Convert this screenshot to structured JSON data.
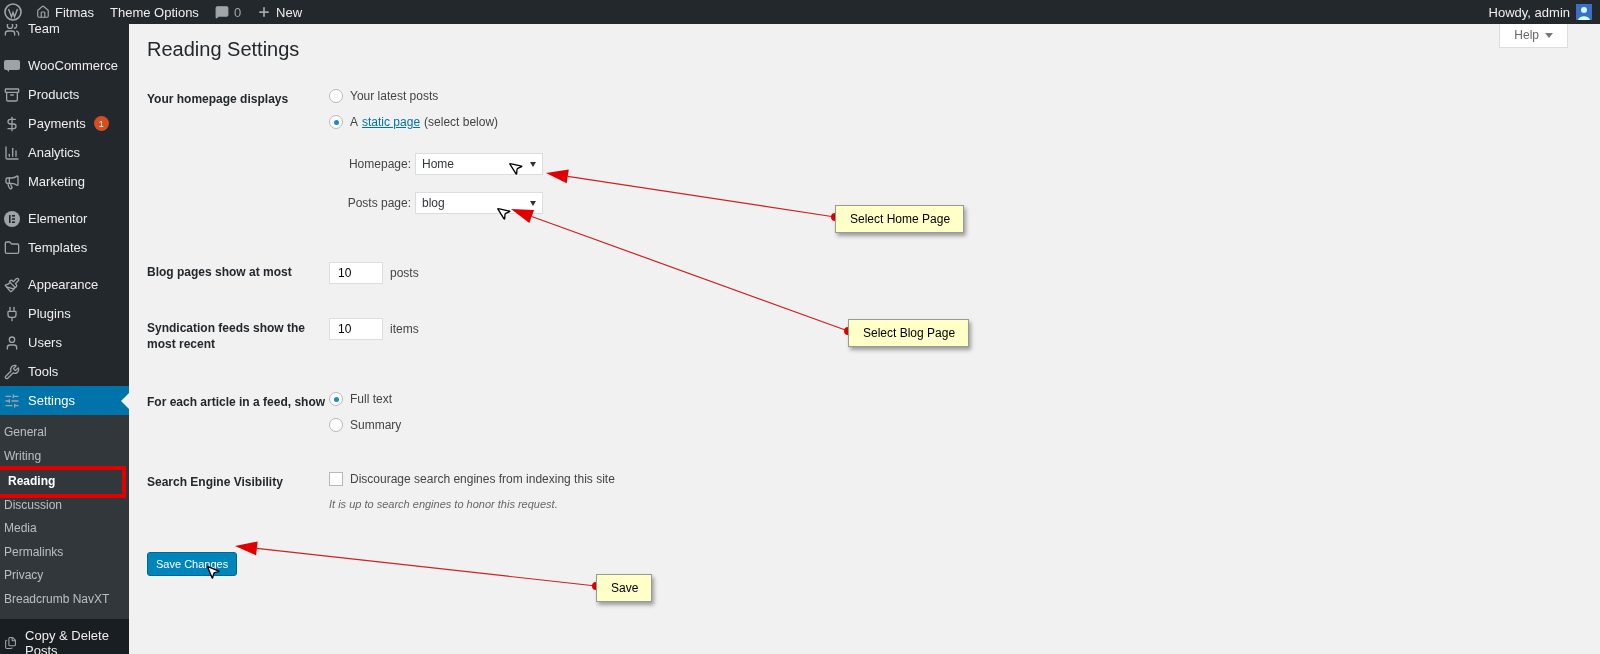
{
  "admin_bar": {
    "items": [
      {
        "kind": "logo"
      },
      {
        "kind": "home",
        "label": "Fitmas"
      },
      {
        "kind": "text",
        "label": "Theme Options"
      },
      {
        "kind": "comments",
        "label": "0"
      },
      {
        "kind": "new",
        "label": "New"
      }
    ],
    "account": "Howdy, admin"
  },
  "sidebar": {
    "groups": [
      [
        {
          "kind": "team",
          "label": "Team",
          "selected": false
        }
      ],
      [
        {
          "kind": "woo",
          "label": "WooCommerce",
          "selected": false
        },
        {
          "kind": "products",
          "label": "Products",
          "selected": false
        },
        {
          "kind": "payments",
          "label": "Payments",
          "badge": "1",
          "selected": false
        },
        {
          "kind": "analytics",
          "label": "Analytics",
          "selected": false
        },
        {
          "kind": "marketing",
          "label": "Marketing",
          "selected": false
        }
      ],
      [
        {
          "kind": "elementor",
          "label": "Elementor",
          "selected": false
        },
        {
          "kind": "templates",
          "label": "Templates",
          "selected": false
        }
      ],
      [
        {
          "kind": "appearance",
          "label": "Appearance",
          "selected": false
        },
        {
          "kind": "plugins",
          "label": "Plugins",
          "selected": false
        },
        {
          "kind": "users",
          "label": "Users",
          "selected": false
        },
        {
          "kind": "tools",
          "label": "Tools",
          "selected": false
        },
        {
          "kind": "settings",
          "label": "Settings",
          "selected": true
        }
      ]
    ],
    "submenu": [
      {
        "label": "General",
        "selected": false,
        "highlighted": false
      },
      {
        "label": "Writing",
        "selected": false,
        "highlighted": false
      },
      {
        "label": "Reading",
        "selected": true,
        "highlighted": true
      },
      {
        "label": "Discussion",
        "selected": false,
        "highlighted": false
      },
      {
        "label": "Media",
        "selected": false,
        "highlighted": false
      },
      {
        "label": "Permalinks",
        "selected": false,
        "highlighted": false
      },
      {
        "label": "Privacy",
        "selected": false,
        "highlighted": false
      },
      {
        "label": "Breadcrumb NavXT",
        "selected": false,
        "highlighted": false
      }
    ],
    "after": [
      {
        "kind": "copy",
        "label": "Copy & Delete Posts",
        "selected": false
      }
    ]
  },
  "help": "Help",
  "title": "Reading Settings",
  "rows": [
    {
      "kind": "radio_group",
      "label": "Your homepage displays",
      "options": [
        {
          "label": "Your latest posts",
          "selected": false
        },
        {
          "prefix": "A",
          "link": "static page",
          "label": "(select below)",
          "selected": true
        }
      ],
      "selects": [
        {
          "label": "Homepage:",
          "value": "Home"
        },
        {
          "label": "Posts page:",
          "value": "blog"
        }
      ]
    },
    {
      "kind": "number",
      "label": "Blog pages show at most",
      "value": "10",
      "unit": "posts"
    },
    {
      "kind": "number",
      "label": "Syndication feeds show the most recent",
      "value": "10",
      "unit": "items"
    },
    {
      "kind": "radio_group",
      "label": "For each article in a feed, show",
      "options": [
        {
          "label": "Full text",
          "selected": true
        },
        {
          "label": "Summary",
          "selected": false
        }
      ]
    },
    {
      "kind": "checkbox",
      "label": "Search Engine Visibility",
      "option": "Discourage search engines from indexing this site",
      "checked": false,
      "hint": "It is up to search engines to honor this request."
    }
  ],
  "save_button": "Save Changes",
  "callouts": [
    {
      "label": "Select Home Page"
    },
    {
      "label": "Select Blog Page"
    },
    {
      "label": "Save"
    }
  ]
}
